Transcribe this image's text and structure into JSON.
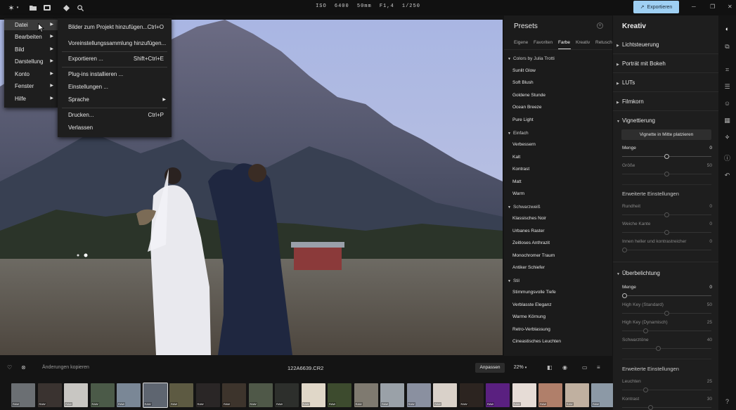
{
  "topbar": {
    "exif": "ISO 6400   50mm   F1,4   1/250",
    "export_label": "Exportieren",
    "icons": [
      "app-logo-icon",
      "folder-icon",
      "library-icon",
      "erase-icon",
      "search-icon"
    ]
  },
  "menu_main": {
    "items": [
      {
        "label": "Datei",
        "active": true
      },
      {
        "label": "Bearbeiten"
      },
      {
        "label": "Bild"
      },
      {
        "label": "Darstellung"
      },
      {
        "label": "Konto"
      },
      {
        "label": "Fenster"
      },
      {
        "label": "Hilfe"
      }
    ]
  },
  "menu_file": {
    "items": [
      {
        "label": "Bilder zum Projekt hinzufügen...",
        "shortcut": "Ctrl+O"
      },
      {
        "label": "Voreinstellungssammlung hinzufügen...",
        "shortcut": ""
      },
      {
        "label": "Exportieren ...",
        "shortcut": "Shift+Ctrl+E"
      },
      {
        "label": "Plug-ins installieren ...",
        "shortcut": ""
      },
      {
        "label": "Einstellungen ...",
        "shortcut": ""
      },
      {
        "label": "Sprache",
        "shortcut": ""
      },
      {
        "label": "Drucken...",
        "shortcut": "Ctrl+P"
      },
      {
        "label": "Verlassen",
        "shortcut": ""
      }
    ]
  },
  "presets": {
    "title": "Presets",
    "tabs": [
      "Eigene",
      "Favoriten",
      "Farbe",
      "Kreativ",
      "Retusch"
    ],
    "active_tab": "Farbe",
    "groups": [
      {
        "name": "Colors by Julia Trotti",
        "items": [
          "Sunlit Glow",
          "Soft Blush",
          "Goldene Stunde",
          "Ocean Breeze",
          "Pure Light"
        ]
      },
      {
        "name": "Einfach",
        "items": [
          "Verbessern",
          "Kalt",
          "Kontrast",
          "Matt",
          "Warm"
        ]
      },
      {
        "name": "Schwarzweiß",
        "items": [
          "Klassisches Noir",
          "Urbanes Raster",
          "Zeitloses Anthrazit",
          "Monochromer Traum",
          "Antiker Schiefer"
        ]
      },
      {
        "name": "Stil",
        "items": [
          "Stimmungsvolle Tiefe",
          "Verblasste Eleganz",
          "Warme Körnung",
          "Retro-Verblassung",
          "Cineastisches Leuchten"
        ]
      }
    ]
  },
  "kreativ": {
    "title": "Kreativ",
    "sections_collapsed": [
      "Lichtsteuerung",
      "Porträt mit Bokeh",
      "LUTs",
      "Filmkorn"
    ],
    "vignette": {
      "title": "Vignettierung",
      "center_button": "Vignette in Mitte platzieren",
      "menge_label": "Menge",
      "menge_value": "0",
      "groesse_label": "Größe",
      "groesse_value": "50",
      "advanced_label": "Erweiterte Einstellungen",
      "rundheit_label": "Rundheit",
      "rundheit_value": "0",
      "weiche_label": "Weiche Kante",
      "weiche_value": "0",
      "innen_label": "Innen heller und kontrastreicher",
      "innen_value": "0"
    },
    "ueber": {
      "title": "Überbelichtung",
      "menge_label": "Menge",
      "menge_value": "0",
      "highkey_std_label": "High Key (Standard)",
      "highkey_std_value": "50",
      "highkey_dyn_label": "High Key (Dynamisch)",
      "highkey_dyn_value": "25",
      "schwarz_label": "Schwarztöne",
      "schwarz_value": "40",
      "advanced_label": "Erweiterte Einstellungen",
      "leuchten_label": "Leuchten",
      "leuchten_value": "25",
      "kontrast_label": "Kontrast",
      "kontrast_value": "30"
    }
  },
  "bottombar": {
    "copy_label": "Änderungen kopieren",
    "filename": "122A6639.CR2",
    "fit_label": "Anpassen",
    "zoom": "22%"
  },
  "filmstrip": {
    "badge": "RAW",
    "thumb_colors": [
      "#6b6f73",
      "#3a3330",
      "#c8c6c2",
      "#4b5a48",
      "#7a8796",
      "#5e6570",
      "#5d5a42",
      "#2a2626",
      "#3d342c",
      "#4f5848",
      "#2d2f2c",
      "#e0d7c8",
      "#3d4b2e",
      "#7f7a70",
      "#9aa1a8",
      "#8a90a0",
      "#d9d1c9",
      "#2c2420",
      "#5a2080",
      "#e6dcd6",
      "#b07f6a",
      "#c0b0a0",
      "#8c99a6",
      "#f0eeea"
    ]
  }
}
